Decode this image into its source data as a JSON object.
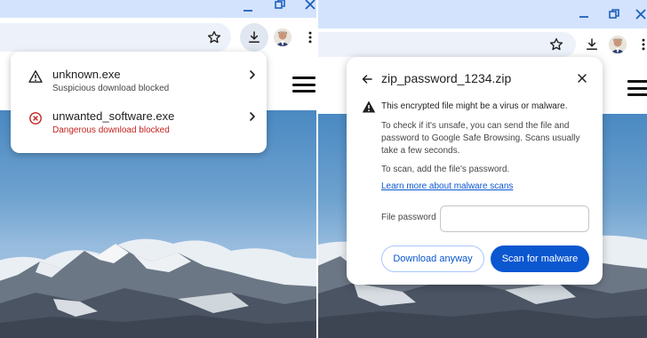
{
  "icons": {
    "minimize": "minimize-icon",
    "maximize": "restore-icon",
    "close": "close-icon",
    "star": "star-icon",
    "download": "download-icon",
    "menu": "more-vert-icon",
    "hamburger": "hamburger-menu-icon",
    "warning": "warning-icon",
    "dangerous": "dangerous-icon",
    "chevron": "chevron-right-icon",
    "back": "arrow-back-icon"
  },
  "colors": {
    "titlebar": "#d3e3fd",
    "accent": "#0b57d0",
    "danger": "#c5221f",
    "sky": "#6ea2cf"
  },
  "left": {
    "downloads": [
      {
        "name": "unknown.exe",
        "status": "Suspicious download blocked",
        "severity": "warning"
      },
      {
        "name": "unwanted_software.exe",
        "status": "Dangerous download blocked",
        "severity": "danger"
      }
    ]
  },
  "right": {
    "dialog": {
      "title": "zip_password_1234.zip",
      "warning": "This encrypted file might be a virus or malware.",
      "body_lines": [
        "To check if it's unsafe, you can send the file and",
        "password to Google Safe Browsing. Scans usually",
        "take a few seconds."
      ],
      "instruction": "To scan, add the file's password.",
      "learn_more": "Learn more about malware scans",
      "password_label": "File password",
      "password_value": "",
      "download_anyway": "Download anyway",
      "scan": "Scan for malware"
    }
  }
}
